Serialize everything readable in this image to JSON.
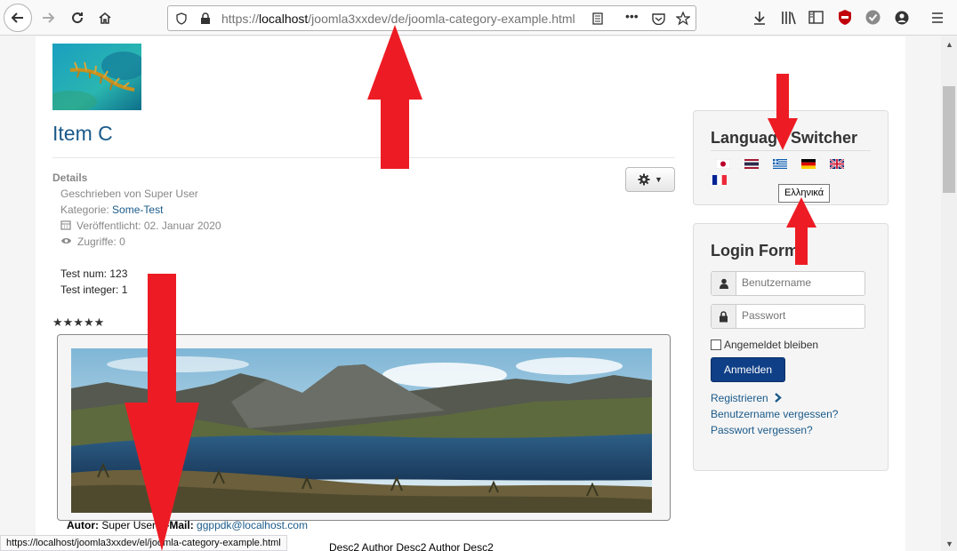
{
  "browser": {
    "url_prefix": "https://",
    "url_host": "localhost",
    "url_path": "/joomla3xxdev/de/joomla-category-example.html",
    "status_url": "https://localhost/joomla3xxdev/el/joomla-category-example.html"
  },
  "article": {
    "title": "Item C",
    "details_heading": "Details",
    "written_by": "Geschrieben von Super User",
    "category_label": "Kategorie: ",
    "category_value": "Some-Test",
    "published": "Veröffentlicht: 02. Januar 2020",
    "hits": "Zugriffe: 0",
    "test_num": "Test num: 123",
    "test_integer": "Test integer: 1",
    "rating_stars": "★★★★★",
    "rating_value": 5,
    "author_label": "Autor:",
    "author_value": " Super User ",
    "email_label": "E-Mail:",
    "email_value": "ggppdk@localhost.com",
    "desc_text": "Desc2 Author Desc2 Author Desc2"
  },
  "language_switcher": {
    "title": "Language Switcher",
    "tooltip": "Ελληνικά",
    "flags": [
      "flag-japan-icon",
      "flag-thailand-icon",
      "flag-greece-icon",
      "flag-germany-icon",
      "flag-uk-icon",
      "flag-france-icon"
    ]
  },
  "login_form": {
    "title": "Login Form",
    "username_placeholder": "Benutzername",
    "password_placeholder": "Passwort",
    "remember_label": "Angemeldet bleiben",
    "login_button": "Anmelden",
    "register_link": "Registrieren",
    "forgot_username": "Benutzername vergessen?",
    "forgot_password": "Passwort vergessen?"
  },
  "colors": {
    "accent": "#1a5a8a",
    "login_button": "#0f3f86",
    "annotation_arrow": "#ed1c24"
  }
}
